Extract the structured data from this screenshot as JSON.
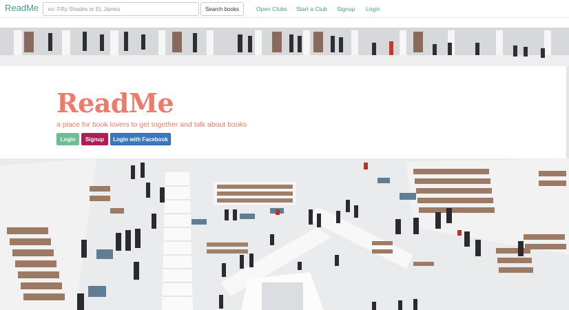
{
  "navbar": {
    "brand": "ReadMe",
    "search": {
      "placeholder": "ex: Fifty Shades or EL James",
      "value": ""
    },
    "search_button": "Search books",
    "links": [
      "Open Clubs",
      "Start a Club",
      "Signup",
      "Login"
    ]
  },
  "hero": {
    "title": "ReadMe",
    "tagline": "a place for book lovers to get together and talk about books",
    "buttons": {
      "login": "Login",
      "signup": "Signup",
      "facebook": "Login with Facebook"
    }
  },
  "colors": {
    "accent": "#f07a6a",
    "nav_link": "#4a9d8a",
    "login_btn": "#6cbf94",
    "signup_btn": "#b01e58",
    "facebook_btn": "#3b78c2"
  }
}
